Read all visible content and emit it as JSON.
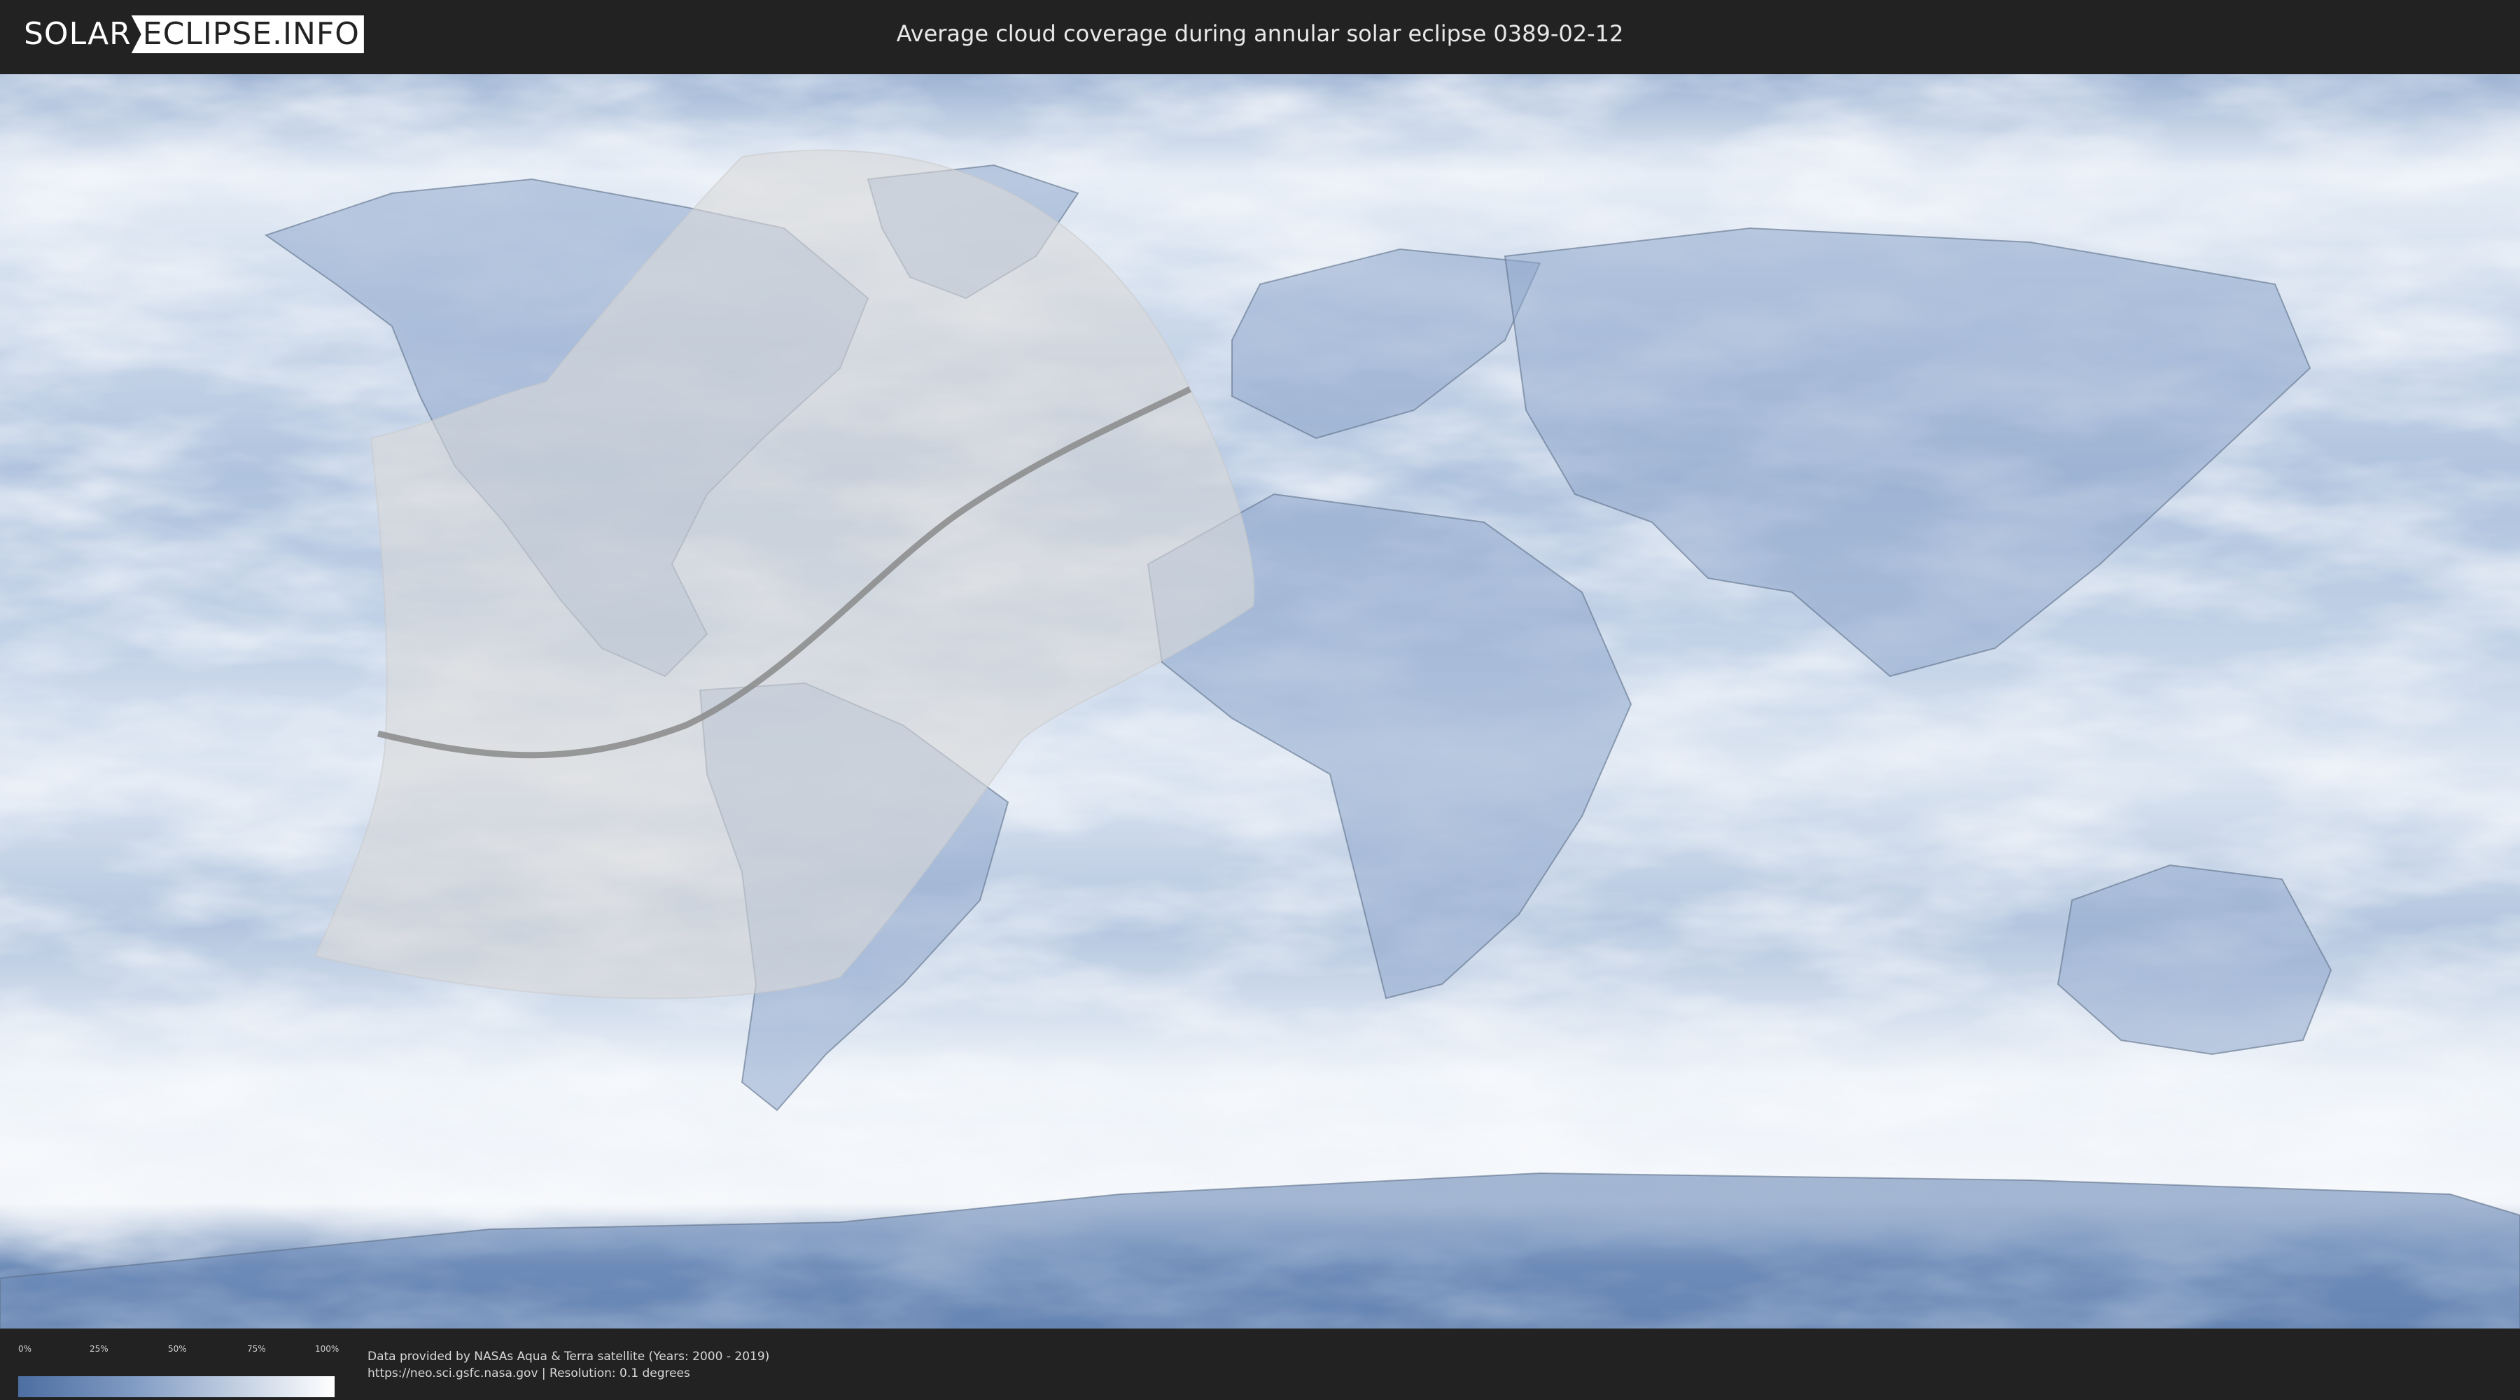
{
  "header": {
    "logo_left": "SOLAR",
    "logo_right": "ECLIPSE.INFO",
    "title": "Average cloud coverage during annular solar eclipse 0389-02-12"
  },
  "legend": {
    "ticks": [
      "0%",
      "25%",
      "50%",
      "75%",
      "100%"
    ],
    "colors": {
      "low": "#4c6ea1",
      "high": "#ffffff"
    }
  },
  "credits": {
    "line1": "Data provided by NASAs Aqua & Terra satellite (Years: 2000 - 2019)",
    "line2": "https://neo.sci.gsfc.nasa.gov | Resolution: 0.1 degrees"
  },
  "map": {
    "projection": "equirectangular",
    "layer": "average cloud coverage",
    "colors": {
      "ocean_base": "#b9cbe2",
      "clear_land": "#6f8fbd",
      "cloud": "#f2f6fb",
      "eclipse_zone": "#d8d8d8",
      "central_line": "#8a8a8a"
    }
  }
}
